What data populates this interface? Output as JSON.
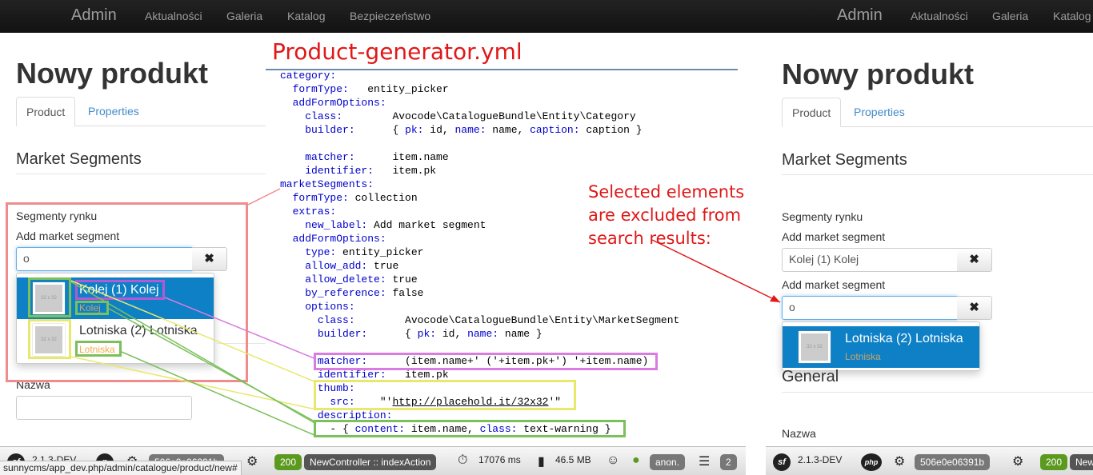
{
  "navbar": {
    "brand": "Admin",
    "links": [
      "Aktualności",
      "Galeria",
      "Katalog",
      "Bezpieczeństwo"
    ]
  },
  "page": {
    "title": "Nowy produkt",
    "tabs": [
      "Product",
      "Properties"
    ],
    "section_market": "Market Segments",
    "section_general": "General",
    "field_segments": "Segmenty rynku",
    "add_segment_label": "Add market segment",
    "search_value": "o",
    "selected_value": "Kolej (1) Kolej",
    "remove_symbol": "✖",
    "nazwa_label": "Nazwa"
  },
  "dropdown_left": [
    {
      "title": "Kolej (1) Kolej",
      "desc": "Kolej",
      "thumb": "32 x 32"
    },
    {
      "title": "Lotniska (2) Lotniska",
      "desc": "Lotniska",
      "thumb": "32 x 32"
    }
  ],
  "dropdown_right": [
    {
      "title": "Lotniska (2) Lotniska",
      "desc": "Lotniska",
      "thumb": "32 x 32"
    }
  ],
  "code": {
    "title": "Product-generator.yml",
    "annotation": "Selected elements are excluded from search results:"
  },
  "toolbar": {
    "sf_version": "2.1.3-DEV",
    "php_label": "php",
    "token": "506e0e06391b",
    "status": "200",
    "controller": "NewController :: indexAction",
    "time": "17076 ms",
    "memory": "46.5 MB",
    "user": "anon.",
    "queries": "2",
    "url": "sunnycms/app_dev.php/admin/catalogue/product/new#",
    "status_right": "200",
    "controller_right": "New"
  },
  "colors": {
    "annotation_red": "#e01818",
    "active_blue": "#0e80c6",
    "warning": "#f0ad4e"
  }
}
